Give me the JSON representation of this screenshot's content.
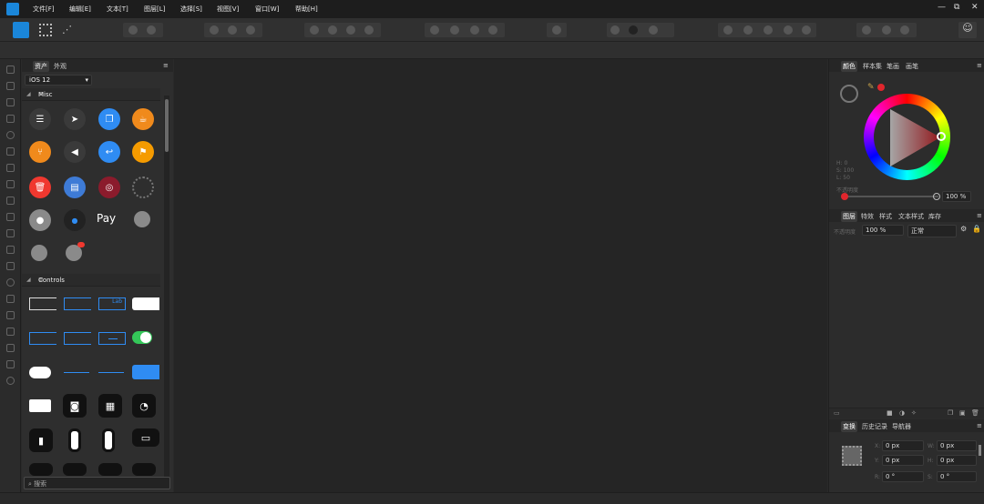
{
  "menu": [
    "文件[F]",
    "编辑[E]",
    "文本[T]",
    "图层[L]",
    "选择[S]",
    "视图[V]",
    "窗口[W]",
    "帮助[H]"
  ],
  "window_controls": {
    "minimize": "—",
    "restore": "⧉",
    "close": "✕"
  },
  "left_panel": {
    "tabs": [
      "资产",
      "外观"
    ],
    "asset_set": "iOS 12",
    "misc_section": "Misc",
    "controls_section": "Controls",
    "control_label": "Lab",
    "apple_pay": "Pay",
    "search_placeholder": "搜索"
  },
  "right_panel": {
    "color_tabs": [
      "颜色",
      "样本集",
      "笔画",
      "画笔"
    ],
    "opacity_label": "不透明度",
    "opacity_value": "100 %",
    "hsl": [
      "H: 0",
      "S: 100",
      "L: 50"
    ],
    "layer_tabs": [
      "图层",
      "特效",
      "样式",
      "文本样式",
      "库存"
    ],
    "layer_opacity_label": "不透明度",
    "layer_opacity": "100 %",
    "blend_mode": "正常",
    "transform_tabs": [
      "变换",
      "历史记录",
      "导航器"
    ],
    "transform": {
      "x_label": "X:",
      "x": "0 px",
      "y_label": "Y:",
      "y": "0 px",
      "w_label": "W:",
      "w": "0 px",
      "h_label": "H:",
      "h": "0 px",
      "r_label": "R:",
      "r": "0 °",
      "s_label": "S:",
      "s": "0 °"
    }
  },
  "colors": {
    "accent": "#1a86d9",
    "hue_red": "#e0262d"
  }
}
